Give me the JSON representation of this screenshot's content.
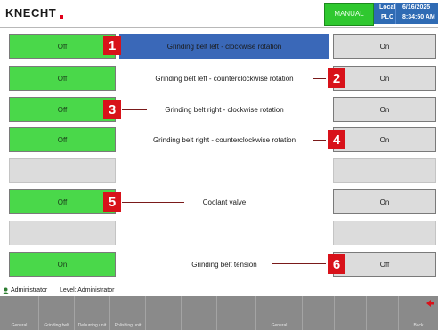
{
  "header": {
    "logo": "KNECHT",
    "mode": "MANUAL",
    "local_label": "Local",
    "plc_label": "PLC",
    "date": "6/16/2025",
    "time": "8:34:50 AM"
  },
  "rows": [
    {
      "left": "Off",
      "label": "Grinding belt left - clockwise rotation",
      "right": "On",
      "badge": "1"
    },
    {
      "left": "Off",
      "label": "Grinding belt left - counterclockwise rotation",
      "right": "On",
      "badge": "2"
    },
    {
      "left": "Off",
      "label": "Grinding belt right - clockwise rotation",
      "right": "On",
      "badge": "3"
    },
    {
      "left": "Off",
      "label": "Grinding belt right - counterclockwise rotation",
      "right": "On",
      "badge": "4"
    },
    {
      "left": "",
      "label": "",
      "right": "",
      "badge": ""
    },
    {
      "left": "Off",
      "label": "Coolant valve",
      "right": "On",
      "badge": "5"
    },
    {
      "left": "",
      "label": "",
      "right": "",
      "badge": ""
    },
    {
      "left": "On",
      "label": "Grinding belt tension",
      "right": "Off",
      "badge": "6"
    }
  ],
  "user": {
    "name": "Administrator",
    "level": "Level: Administrator"
  },
  "nav": [
    "General",
    "Grinding belt",
    "Deburring unit",
    "Polishing unit",
    "",
    "",
    "",
    "General",
    "",
    "",
    "",
    "Back"
  ],
  "colors": {
    "active_green": "#4ad84a",
    "selected_blue": "#3a68b8",
    "badge_red": "#d8121a",
    "header_blue": "#2f6bb4",
    "nav_grey": "#8a8a8a"
  }
}
